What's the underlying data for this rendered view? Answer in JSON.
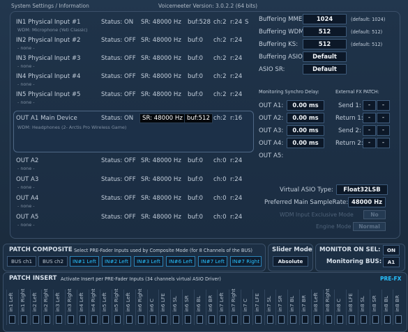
{
  "header": {
    "left_title": "System Settings / Information",
    "version": "Voicemeeter Version: 3.0.2.2 (64 bits)"
  },
  "inputs": [
    {
      "name": "IN1 Physical Input #1",
      "sub": "WDM: Microphone (Yeti Classic)",
      "status": "Status: ON",
      "sr": "SR: 48000 Hz",
      "buf": "buf:528",
      "ch": "ch:2",
      "r": "r:24",
      "extra": "S"
    },
    {
      "name": "IN2 Physical Input #2",
      "sub": "- none -",
      "status": "Status: OFF",
      "sr": "SR: 48000 Hz",
      "buf": "buf:0",
      "ch": "ch:2",
      "r": "r:24",
      "extra": ""
    },
    {
      "name": "IN3 Physical Input #3",
      "sub": "- none -",
      "status": "Status: OFF",
      "sr": "SR: 48000 Hz",
      "buf": "buf:0",
      "ch": "ch:2",
      "r": "r:24",
      "extra": ""
    },
    {
      "name": "IN4 Physical Input #4",
      "sub": "- none -",
      "status": "Status: OFF",
      "sr": "SR: 48000 Hz",
      "buf": "buf:0",
      "ch": "ch:2",
      "r": "r:24",
      "extra": ""
    },
    {
      "name": "IN5 Physical Input #5",
      "sub": "- none -",
      "status": "Status: OFF",
      "sr": "SR: 48000 Hz",
      "buf": "buf:0",
      "ch": "ch:2",
      "r": "r:24",
      "extra": ""
    }
  ],
  "outputs": [
    {
      "name": "OUT A1 Main Device",
      "sub": "WDM: Headphones (2- Arctis Pro Wireless Game)",
      "status": "Status: ON",
      "sr": "SR: 48000 Hz",
      "buf": "buf:512",
      "ch": "ch:2",
      "r": "r:16"
    },
    {
      "name": "OUT A2",
      "sub": "- none -",
      "status": "Status: OFF",
      "sr": "SR: 48000 Hz",
      "buf": "buf:0",
      "ch": "ch:0",
      "r": "r:24"
    },
    {
      "name": "OUT A3",
      "sub": "- none -",
      "status": "Status: OFF",
      "sr": "SR: 48000 Hz",
      "buf": "buf:0",
      "ch": "ch:0",
      "r": "r:24"
    },
    {
      "name": "OUT A4",
      "sub": "- none -",
      "status": "Status: OFF",
      "sr": "SR: 48000 Hz",
      "buf": "buf:0",
      "ch": "ch:0",
      "r": "r:24"
    },
    {
      "name": "OUT A5",
      "sub": "- none -",
      "status": "Status: OFF",
      "sr": "SR: 48000 Hz",
      "buf": "buf:0",
      "ch": "ch:0",
      "r": "r:24"
    }
  ],
  "buffering": [
    {
      "label": "Buffering MME:",
      "value": "1024",
      "default": "(default: 1024)"
    },
    {
      "label": "Buffering WDM:",
      "value": "512",
      "default": "(default: 512)"
    },
    {
      "label": "Buffering KS:",
      "value": "512",
      "default": "(default: 512)"
    },
    {
      "label": "Buffering ASIO:",
      "value": "Default",
      "default": ""
    },
    {
      "label": "ASIO SR:",
      "value": "Default",
      "default": ""
    }
  ],
  "monitoring": {
    "title": "Monitoring Synchro Delay:",
    "rows": [
      {
        "label": "OUT A1:",
        "value": "0.00 ms"
      },
      {
        "label": "OUT A2:",
        "value": "0.00 ms"
      },
      {
        "label": "OUT A3:",
        "value": "0.00 ms"
      },
      {
        "label": "OUT A4:",
        "value": "0.00 ms"
      },
      {
        "label": "OUT A5:",
        "value": ""
      }
    ]
  },
  "fx_patch": {
    "title": "External FX PATCH:",
    "rows": [
      {
        "label": "Send 1:",
        "a": "-",
        "b": "-"
      },
      {
        "label": "Return 1:",
        "a": "-",
        "b": "-"
      },
      {
        "label": "Send 2:",
        "a": "-",
        "b": "-"
      },
      {
        "label": "Return 2:",
        "a": "-",
        "b": "-"
      }
    ]
  },
  "asio": {
    "type_label": "Virtual ASIO Type:",
    "type_value": "Float32LSB",
    "sr_label": "Preferred Main SampleRate:",
    "sr_value": "48000 Hz",
    "exclusive_label": "WDM Input Exclusive Mode",
    "exclusive_value": "No",
    "engine_label": "Engine Mode",
    "engine_value": "Normal"
  },
  "patch_composite": {
    "title": "PATCH COMPOSITE",
    "desc": "Select PRE-Fader Inputs used by Composite Mode (for 8 Channels of the BUS)",
    "buttons": [
      "BUS ch1",
      "BUS ch2",
      "IN#1 Left",
      "IN#2 Left",
      "IN#3 Left",
      "IN#6 Left",
      "IN#7 Left",
      "IN#7 Right"
    ]
  },
  "slider_mode": {
    "title": "Slider Mode",
    "value": "Absolute"
  },
  "monitor": {
    "title": "MONITOR ON SEL:",
    "toggle": "ON",
    "bus_label": "Monitoring BUS:",
    "bus_value": "A1"
  },
  "patch_insert": {
    "title": "PATCH INSERT",
    "desc": "Activate Insert per PRE-Fader Inputs (34 channels virtual ASIO Driver)",
    "pre_fx": "PRE-FX",
    "channels": [
      "in1 Left",
      "in1 Right",
      "in2 Left",
      "in2 Right",
      "in3 Left",
      "in3 Right",
      "in4 Left",
      "in4 Right",
      "in5 Left",
      "in5 Right",
      "in6 Left",
      "in6 Right",
      "in6 C",
      "in6 LFE",
      "in6 SL",
      "in6 SR",
      "in6 BL",
      "in6 BR",
      "in7 Left",
      "in7 Right",
      "in7 C",
      "in7 LFE",
      "in7 SL",
      "in7 SR",
      "in7 BL",
      "in7 BR",
      "in8 Left",
      "in8 Right",
      "in8 C",
      "in8 LFE",
      "in8 SL",
      "in8 SR",
      "in8 BL",
      "in8 BR"
    ]
  },
  "colors": {
    "accent": "#27c1ff",
    "bg": "#1b2a3a"
  }
}
